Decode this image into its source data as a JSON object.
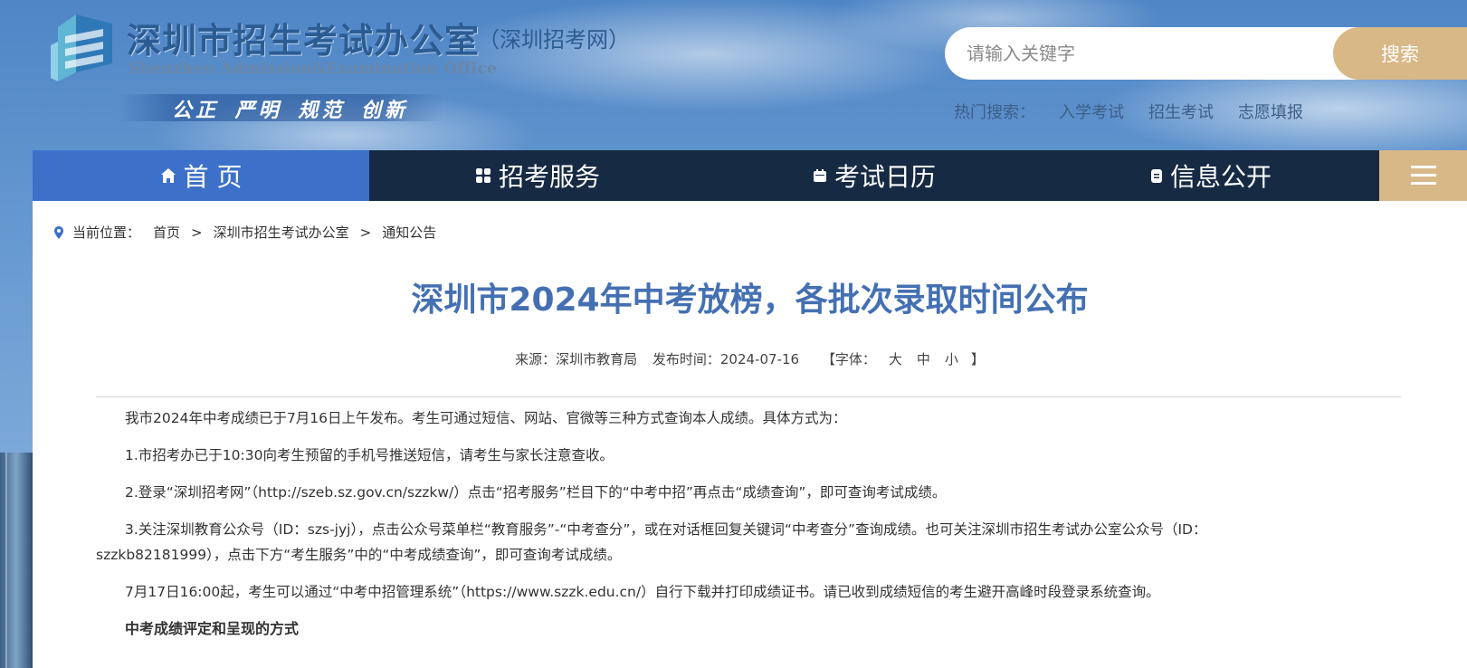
{
  "header": {
    "site_name": "深圳市招生考试办公室",
    "site_sub": "（深圳招考网）",
    "site_en": "Shenzhen Admission&Examination Office",
    "slogan": "公正 严明 规范 创新"
  },
  "search": {
    "placeholder": "请输入关键字",
    "button_label": "搜索",
    "hot_label": "热门搜索：",
    "hot_links": [
      "入学考试",
      "招生考试",
      "志愿填报"
    ]
  },
  "nav": {
    "items": [
      {
        "icon": "home-icon",
        "label": "首 页",
        "active": true
      },
      {
        "icon": "grid-icon",
        "label": "招考服务",
        "active": false
      },
      {
        "icon": "calendar-icon",
        "label": "考试日历",
        "active": false
      },
      {
        "icon": "document-icon",
        "label": "信息公开",
        "active": false
      }
    ]
  },
  "breadcrumb": {
    "label": "当前位置：",
    "items": [
      "首页",
      "深圳市招生考试办公室",
      "通知公告"
    ],
    "separator": ">"
  },
  "article": {
    "title": "深圳市2024年中考放榜，各批次录取时间公布",
    "source": "来源：深圳市教育局",
    "publish_time": "发布时间：2024-07-16",
    "font_label": "【字体：",
    "font_sizes": [
      "大",
      "中",
      "小"
    ],
    "font_close": "】",
    "paragraphs": [
      "我市2024年中考成绩已于7月16日上午发布。考生可通过短信、网站、官微等三种方式查询本人成绩。具体方式为：",
      "1.市招考办已于10:30向考生预留的手机号推送短信，请考生与家长注意查收。",
      "2.登录“深圳招考网”（http://szeb.sz.gov.cn/szzkw/）点击“招考服务”栏目下的“中考中招”再点击“成绩查询”，即可查询考试成绩。",
      "3.关注深圳教育公众号（ID：szs-jyj），点击公众号菜单栏“教育服务”-“中考查分”，或在对话框回复关键词“中考查分”查询成绩。也可关注深圳市招生考试办公室公众号（ID：szzkb82181999），点击下方“考生服务”中的“中考成绩查询”，即可查询考试成绩。",
      "7月17日16:00起，考生可以通过“中考中招管理系统”（https://www.szzk.edu.cn/）自行下载并打印成绩证书。请已收到成绩短信的考生避开高峰时段登录系统查询。"
    ],
    "subheading": "中考成绩评定和呈现的方式"
  },
  "colors": {
    "nav_bg": "#162a44",
    "nav_active": "#3d71c9",
    "accent_gold": "#d9b888",
    "title_blue": "#4470b3"
  }
}
